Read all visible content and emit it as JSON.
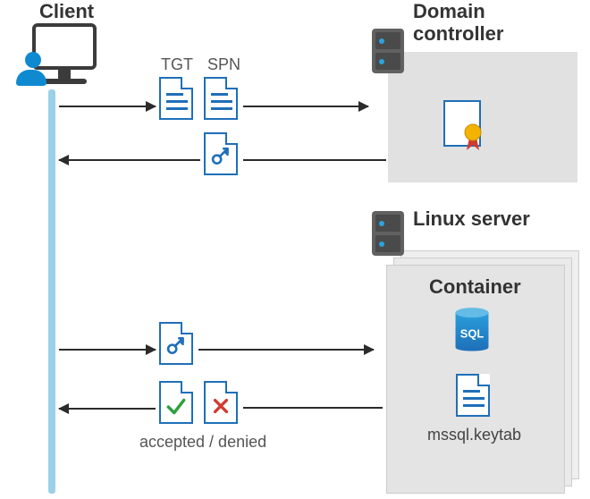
{
  "labels": {
    "client": "Client",
    "tgt": "TGT",
    "spn": "SPN",
    "domain_controller_l1": "Domain",
    "domain_controller_l2": "controller",
    "linux_server": "Linux server",
    "container": "Container",
    "accepted_denied": "accepted / denied",
    "keytab_file": "mssql.keytab",
    "sql_badge": "SQL"
  },
  "flows": [
    {
      "from": "client",
      "to": "domain-controller",
      "payload": [
        "TGT",
        "SPN"
      ],
      "direction": "right"
    },
    {
      "from": "domain-controller",
      "to": "client",
      "payload": [
        "service-ticket-key"
      ],
      "direction": "left"
    },
    {
      "from": "client",
      "to": "linux-server-container",
      "payload": [
        "service-ticket-key"
      ],
      "direction": "right"
    },
    {
      "from": "linux-server-container",
      "to": "client",
      "payload": [
        "accepted",
        "denied"
      ],
      "direction": "left"
    }
  ],
  "entities": {
    "client": {
      "type": "workstation-user"
    },
    "domain_controller": {
      "type": "server",
      "artifact": "certificate"
    },
    "linux_server": {
      "type": "server",
      "container": {
        "service": "SQL",
        "keytab": "mssql.keytab"
      }
    }
  },
  "colors": {
    "azure_blue": "#1f6fb8",
    "light_blue": "#9bd1e8",
    "grey_panel": "#e1e1e1",
    "server_grey": "#616161",
    "accept_green": "#2e9e3f",
    "deny_red": "#d13a2e",
    "ribbon_gold": "#f3b300"
  }
}
